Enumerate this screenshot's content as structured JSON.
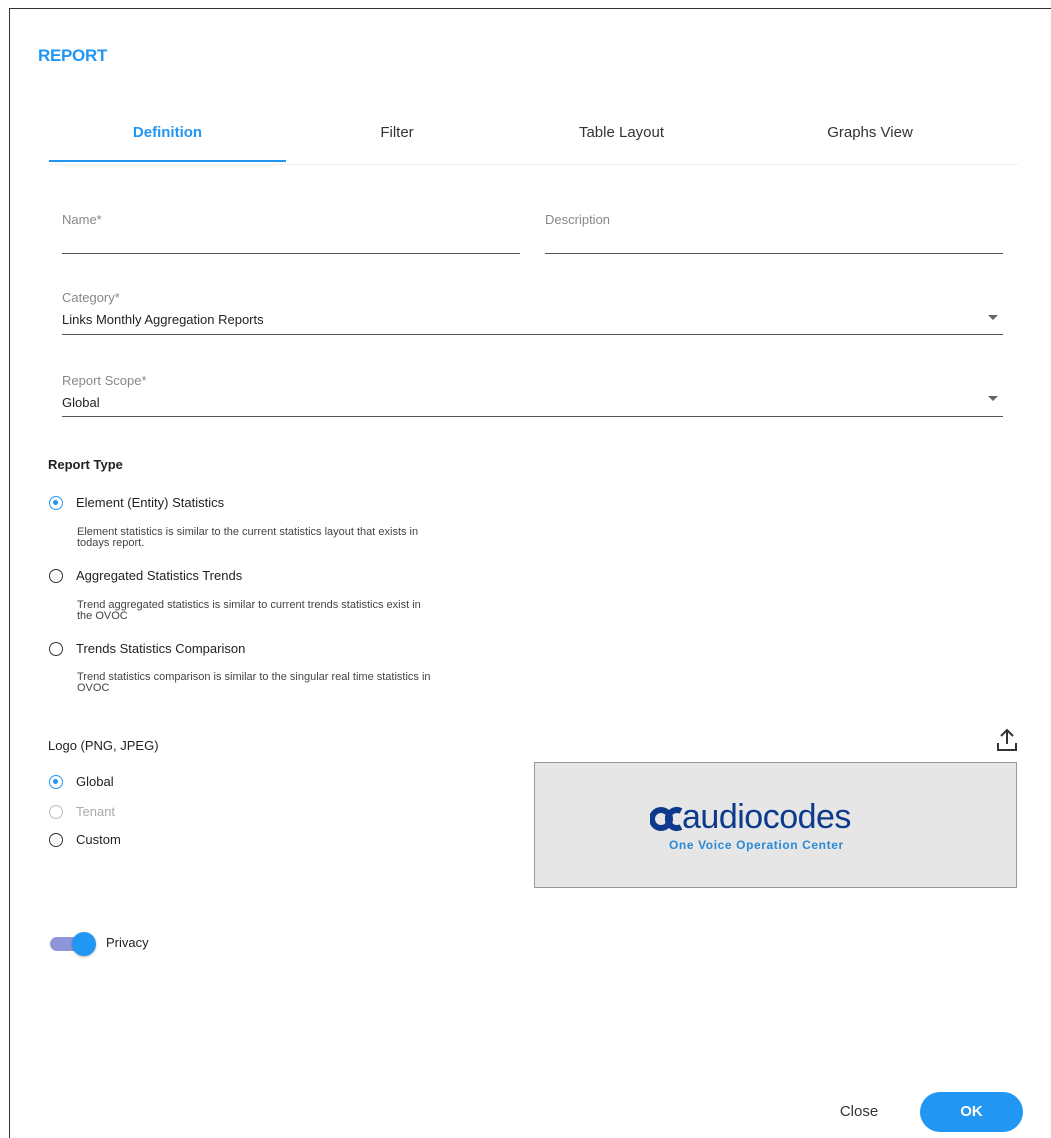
{
  "dialog": {
    "title": "REPORT"
  },
  "tabs": [
    {
      "label": "Definition",
      "active": true
    },
    {
      "label": "Filter",
      "active": false
    },
    {
      "label": "Table Layout",
      "active": false
    },
    {
      "label": "Graphs View",
      "active": false
    }
  ],
  "fields": {
    "name": {
      "label": "Name*",
      "value": ""
    },
    "description": {
      "label": "Description",
      "value": ""
    },
    "category": {
      "label": "Category*",
      "value": "Links Monthly Aggregation Reports"
    },
    "report_scope": {
      "label": "Report Scope*",
      "value": "Global"
    }
  },
  "report_type": {
    "title": "Report Type",
    "options": [
      {
        "label": "Element (Entity) Statistics",
        "checked": true,
        "description": "Element statistics is similar to the current statistics layout that exists in todays report."
      },
      {
        "label": "Aggregated Statistics Trends",
        "checked": false,
        "description": "Trend aggregated statistics is similar to current trends statistics exist in the OVOC"
      },
      {
        "label": "Trends Statistics Comparison",
        "checked": false,
        "description": "Trend statistics comparison is similar to the singular real time statistics in OVOC"
      }
    ]
  },
  "logo": {
    "title": "Logo (PNG, JPEG)",
    "options": [
      {
        "label": "Global",
        "checked": true,
        "disabled": false
      },
      {
        "label": "Tenant",
        "checked": false,
        "disabled": true
      },
      {
        "label": "Custom",
        "checked": false,
        "disabled": false
      }
    ],
    "preview": {
      "brand": "audiocodes",
      "tagline": "One Voice Operation Center"
    }
  },
  "privacy": {
    "label": "Privacy",
    "enabled": true
  },
  "buttons": {
    "close": "Close",
    "ok": "OK"
  },
  "colors": {
    "accent": "#2196f3",
    "brand_dark": "#0d3a8c",
    "brand_light": "#2b8ad6",
    "toggle_track": "#8e96d8"
  }
}
